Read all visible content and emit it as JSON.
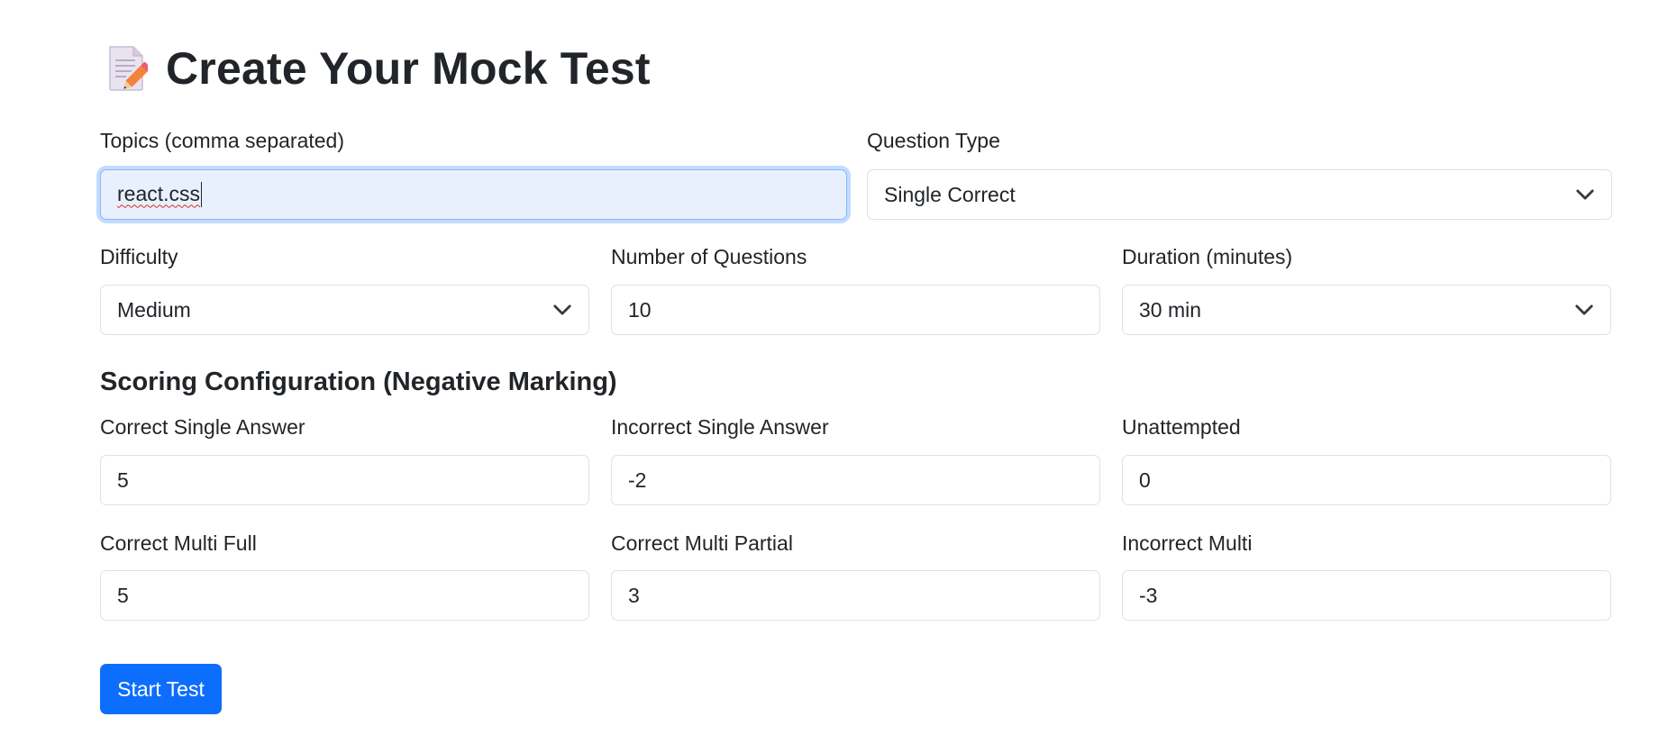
{
  "header": {
    "title": "Create Your Mock Test",
    "icon": "memo-pencil-icon"
  },
  "form": {
    "topics": {
      "label": "Topics (comma separated)",
      "value": "react.css",
      "focused": true
    },
    "question_type": {
      "label": "Question Type",
      "value": "Single Correct"
    },
    "difficulty": {
      "label": "Difficulty",
      "value": "Medium"
    },
    "num_questions": {
      "label": "Number of Questions",
      "value": "10"
    },
    "duration": {
      "label": "Duration (minutes)",
      "value": "30 min"
    }
  },
  "scoring": {
    "title": "Scoring Configuration (Negative Marking)",
    "correct_single": {
      "label": "Correct Single Answer",
      "value": "5"
    },
    "incorrect_single": {
      "label": "Incorrect Single Answer",
      "value": "-2"
    },
    "unattempted": {
      "label": "Unattempted",
      "value": "0"
    },
    "correct_multi_full": {
      "label": "Correct Multi Full",
      "value": "5"
    },
    "correct_multi_partial": {
      "label": "Correct Multi Partial",
      "value": "3"
    },
    "incorrect_multi": {
      "label": "Incorrect Multi",
      "value": "-3"
    }
  },
  "actions": {
    "start_label": "Start Test"
  },
  "colors": {
    "primary": "#0d6efd",
    "focus_border": "#86b7fe",
    "focus_bg": "#e8f0fe",
    "border": "#dee2e6",
    "text": "#212529"
  }
}
